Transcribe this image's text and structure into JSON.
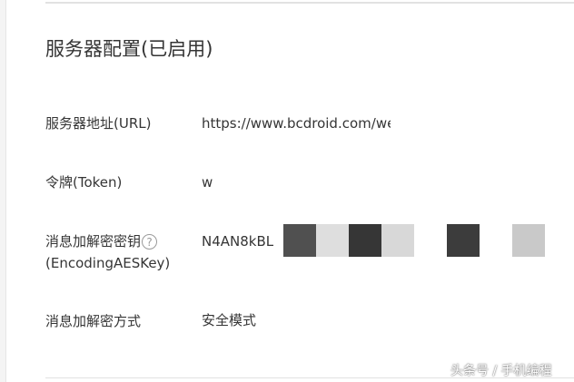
{
  "section": {
    "title": "服务器配置(已启用)"
  },
  "rows": [
    {
      "label": "服务器地址(URL)",
      "value": "https://www.bcdroid.com/weix"
    },
    {
      "label": "令牌(Token)",
      "value": "w"
    },
    {
      "label_line1": "消息加解密密钥",
      "label_line2": "(EncodingAESKey)",
      "help_glyph": "?",
      "value": "N4AN8kBLt"
    },
    {
      "label": "消息加解密方式",
      "value": "安全模式"
    }
  ],
  "icons": {
    "help": "question-circle-icon"
  },
  "mosaic_colors": [
    "#505050",
    "#dedede",
    "#363636",
    "#d8d8d8",
    "#3c3c3c",
    "#c9c9c9"
  ],
  "watermark": "头条号 / 手机编程"
}
